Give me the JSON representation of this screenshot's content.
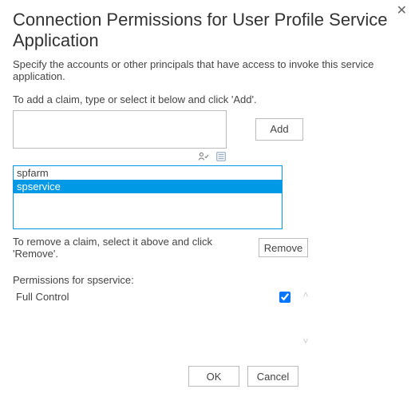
{
  "dialog": {
    "title": "Connection Permissions for User Profile Service Application",
    "description": "Specify the accounts or other principals that have access to invoke this service application.",
    "add_instruction": "To add a claim, type or select it below and click 'Add'.",
    "remove_instruction": "To remove a claim, select it above and click 'Remove'.",
    "permissions_for_prefix": "Permissions for "
  },
  "buttons": {
    "add": "Add",
    "remove": "Remove",
    "ok": "OK",
    "cancel": "Cancel",
    "close": "✕"
  },
  "icons": {
    "people_picker": "people-picker-icon",
    "browse": "browse-icon"
  },
  "claim_input_value": "",
  "claims": [
    {
      "name": "spfarm",
      "selected": false
    },
    {
      "name": "spservice",
      "selected": true
    }
  ],
  "selected_principal": "spservice",
  "permissions": [
    {
      "label": "Full Control",
      "checked": true
    }
  ]
}
